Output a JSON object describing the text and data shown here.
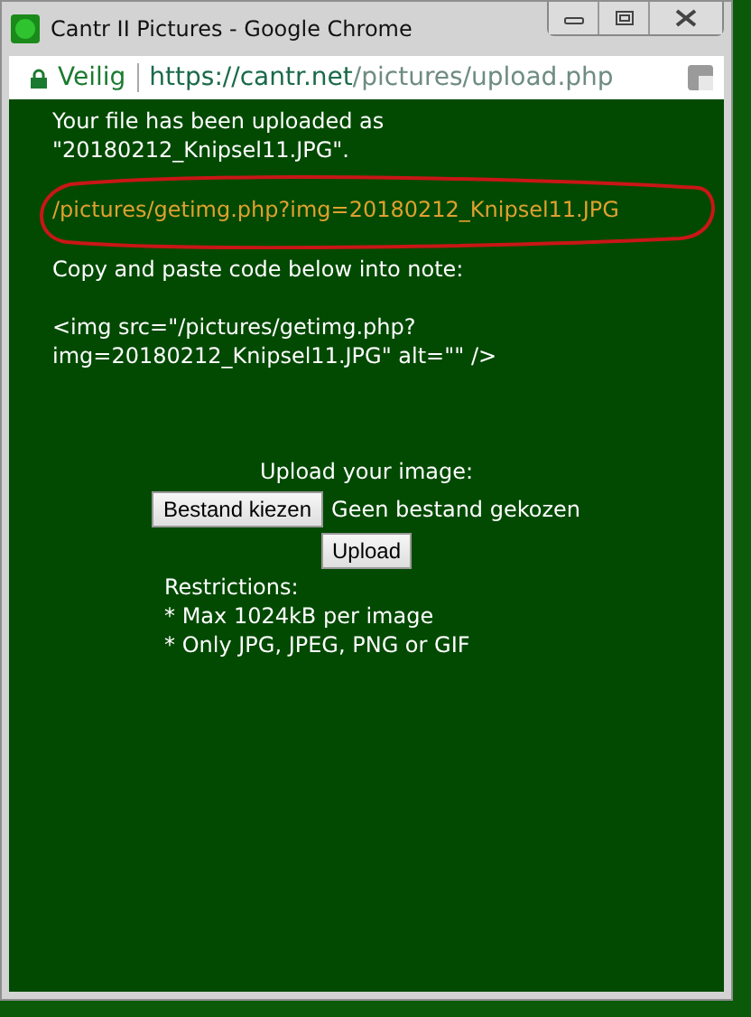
{
  "window": {
    "title": "Cantr II Pictures - Google Chrome"
  },
  "address_bar": {
    "security": "Veilig",
    "url_host": "https://cantr.net",
    "url_path": "/pictures/upload.php"
  },
  "message": {
    "lines": [
      "Your file has been uploaded as",
      "\"20180212_Knipsel11.JPG\"."
    ],
    "link": "/pictures/getimg.php?img=20180212_Knipsel11.JPG",
    "link_circled": true,
    "instruction": "Copy and paste code below into note:",
    "code_lines": [
      "<img src=\"/pictures/getimg.php?",
      "img=20180212_Knipsel11.JPG\" alt=\"\" />"
    ]
  },
  "upload_form": {
    "heading": "Upload your image:",
    "choose_button": "Bestand kiezen",
    "file_status": "Geen bestand gekozen",
    "upload_button": "Upload",
    "restrictions": [
      "Restrictions:",
      "* Max 1024kB per image",
      "* Only JPG, JPEG, PNG or GIF"
    ]
  }
}
